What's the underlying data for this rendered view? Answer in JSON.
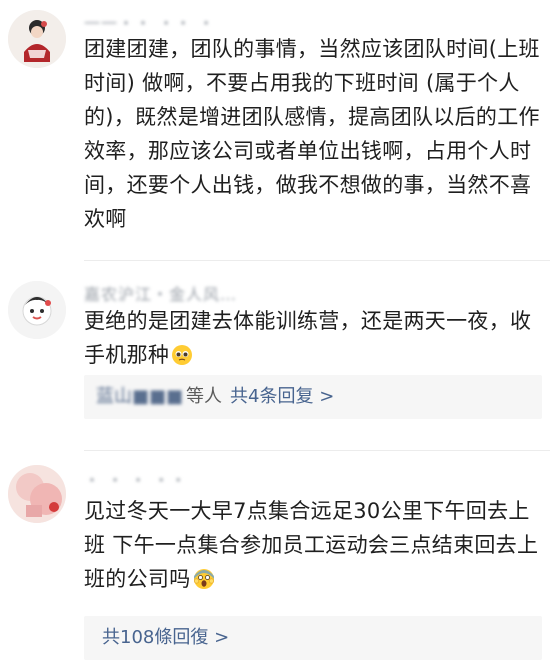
{
  "comments": [
    {
      "username": "一一・・ ・・ ・",
      "avatar_icon": "cartoon-avatar-icon",
      "text": "团建团建，团队的事情，当然应该团队时间(上班时间) 做啊，不要占用我的下班时间 (属于个人的)，既然是增进团队感情，提高团队以后的工作效率，那应该公司或者单位出钱啊，占用个人时间，还要个人出钱，做我不想做的事，当然不喜欢啊"
    },
    {
      "username": "嘉农沪江・金人风…",
      "avatar_icon": "cartoon-avatar-icon",
      "text": "更绝的是团建去体能训练营，还是两天一夜，收手机那种",
      "emoji_icon": "pleading-face-emoji-icon",
      "reply": {
        "names": "蓝山■■■",
        "suffix": "等人",
        "link": "共4条回复 >"
      }
    },
    {
      "username": "・ ・ ・ ・・",
      "avatar_icon": "photo-avatar-icon",
      "text": "见过冬天一大早7点集合远足30公里下午回去上班 下午一点集合参加员工运动会三点结束回去上班的公司吗",
      "emoji_icon": "screaming-face-emoji-icon",
      "reply": {
        "link": "共108條回復 >"
      }
    }
  ],
  "colors": {
    "link": "#48648f",
    "reply_bg": "#f6f6f6",
    "username": "#9aa0a8",
    "text": "#1f1f1f"
  }
}
